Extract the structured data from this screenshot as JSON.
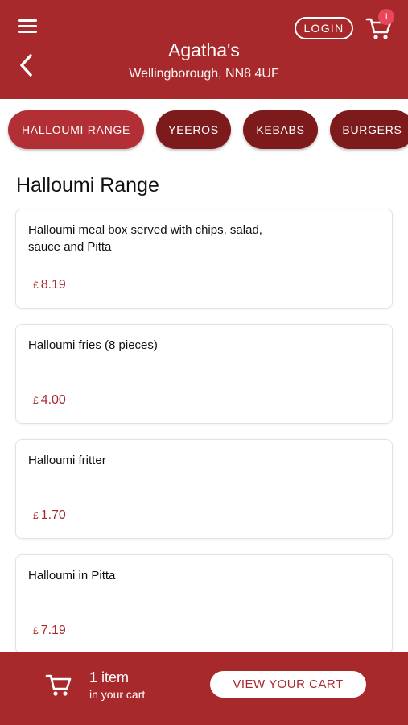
{
  "header": {
    "store_name": "Agatha's",
    "address": "Wellingborough, NN8 4UF",
    "login_label": "LOGIN",
    "cart_badge": "1",
    "menu_icon": "hamburger-menu-icon",
    "back_icon": "chevron-left-icon",
    "cart_icon": "shopping-cart-icon"
  },
  "categories": [
    {
      "label": "HALLOUMI RANGE",
      "active": true
    },
    {
      "label": "YEEROS",
      "active": false
    },
    {
      "label": "KEBABS",
      "active": false
    },
    {
      "label": "BURGERS",
      "active": false
    }
  ],
  "section": {
    "title": "Halloumi Range"
  },
  "items": [
    {
      "name": "Halloumi meal box served with chips, salad, sauce and Pitta",
      "currency": "£",
      "price": "8.19"
    },
    {
      "name": "Halloumi fries (8 pieces)",
      "currency": "£",
      "price": "4.00"
    },
    {
      "name": "Halloumi fritter",
      "currency": "£",
      "price": "1.70"
    },
    {
      "name": "Halloumi in Pitta",
      "currency": "£",
      "price": "7.19"
    }
  ],
  "footer": {
    "count_text": "1 item",
    "count_sub": "in your cart",
    "view_cart_label": "VIEW YOUR CART",
    "cart_icon": "shopping-cart-icon"
  },
  "colors": {
    "brand": "#a8292c",
    "pill_active": "#b23035",
    "pill_inactive": "#7d1a1c",
    "badge": "#e8475a"
  }
}
